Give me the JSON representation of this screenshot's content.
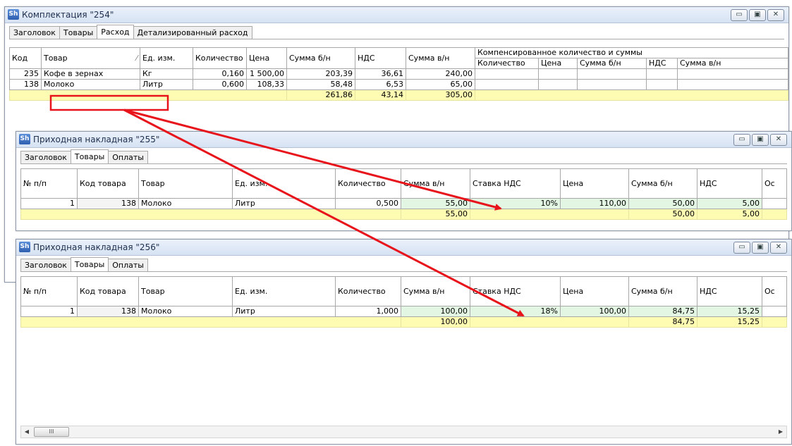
{
  "win1": {
    "icon": "Sh",
    "title": "Комплектация \"254\"",
    "buttons": [
      "▭",
      "▣",
      "✕"
    ],
    "tabs": [
      "Заголовок",
      "Товары",
      "Расход",
      "Детализированный расход"
    ],
    "active_tab": 2,
    "headers": {
      "kod": "Код",
      "tovar": "Товар",
      "sort": "⁄",
      "ed": "Ед. изм.",
      "kol": "Количество",
      "cena": "Цена",
      "sum_bn": "Сумма б/н",
      "nds": "НДС",
      "sum_vn": "Сумма в/н",
      "comp_group": "Компенсированное количество и суммы",
      "c_kol": "Количество",
      "c_cena": "Цена",
      "c_sum_bn": "Сумма б/н",
      "c_nds": "НДС",
      "c_sum_vn": "Сумма в/н"
    },
    "rows": [
      {
        "kod": "235",
        "tovar": "Кофе в зернах",
        "ed": "Кг",
        "kol": "0,160",
        "cena": "1 500,00",
        "sum_bn": "203,39",
        "nds": "36,61",
        "sum_vn": "240,00"
      },
      {
        "kod": "138",
        "tovar": "Молоко",
        "ed": "Литр",
        "kol": "0,600",
        "cena": "108,33",
        "sum_bn": "58,48",
        "nds": "6,53",
        "sum_vn": "65,00"
      }
    ],
    "totals": {
      "sum_bn": "261,86",
      "nds": "43,14",
      "sum_vn": "305,00"
    }
  },
  "win2": {
    "icon": "Sh",
    "title": "Приходная накладная \"255\"",
    "buttons": [
      "▭",
      "▣",
      "✕"
    ],
    "tabs": [
      "Заголовок",
      "Товары",
      "Оплаты"
    ],
    "active_tab": 1,
    "headers": {
      "num": "№ п/п",
      "kod": "Код товара",
      "tovar": "Товар",
      "ed": "Ед. изм.",
      "kol": "Количество",
      "sum_vn": "Сумма в/н",
      "stavka": "Ставка НДС",
      "cena": "Цена",
      "sum_bn": "Сумма б/н",
      "nds": "НДС",
      "ost": "Ос"
    },
    "row": {
      "num": "1",
      "kod": "138",
      "tovar": "Молоко",
      "ed": "Литр",
      "kol": "0,500",
      "sum_vn": "55,00",
      "stavka": "10%",
      "cena": "110,00",
      "sum_bn": "50,00",
      "nds": "5,00"
    },
    "totals": {
      "sum_vn": "55,00",
      "sum_bn": "50,00",
      "nds": "5,00"
    }
  },
  "win3": {
    "icon": "Sh",
    "title": "Приходная накладная \"256\"",
    "buttons": [
      "▭",
      "▣",
      "✕"
    ],
    "tabs": [
      "Заголовок",
      "Товары",
      "Оплаты"
    ],
    "active_tab": 1,
    "headers": {
      "num": "№ п/п",
      "kod": "Код товара",
      "tovar": "Товар",
      "ed": "Ед. изм.",
      "kol": "Количество",
      "sum_vn": "Сумма в/н",
      "stavka": "Ставка НДС",
      "cena": "Цена",
      "sum_bn": "Сумма б/н",
      "nds": "НДС",
      "ost": "Ос"
    },
    "row": {
      "num": "1",
      "kod": "138",
      "tovar": "Молоко",
      "ed": "Литр",
      "kol": "1,000",
      "sum_vn": "100,00",
      "stavka": "18%",
      "cena": "100,00",
      "sum_bn": "84,75",
      "nds": "15,25"
    },
    "totals": {
      "sum_vn": "100,00",
      "sum_bn": "84,75",
      "nds": "15,25"
    },
    "scroll": {
      "left": "◀",
      "right": "▶",
      "thumb": "III"
    }
  },
  "colors": {
    "annotation_red": "#e8141b",
    "totals_row": "#fefcb3",
    "editable_cell": "#e3f6e3"
  }
}
